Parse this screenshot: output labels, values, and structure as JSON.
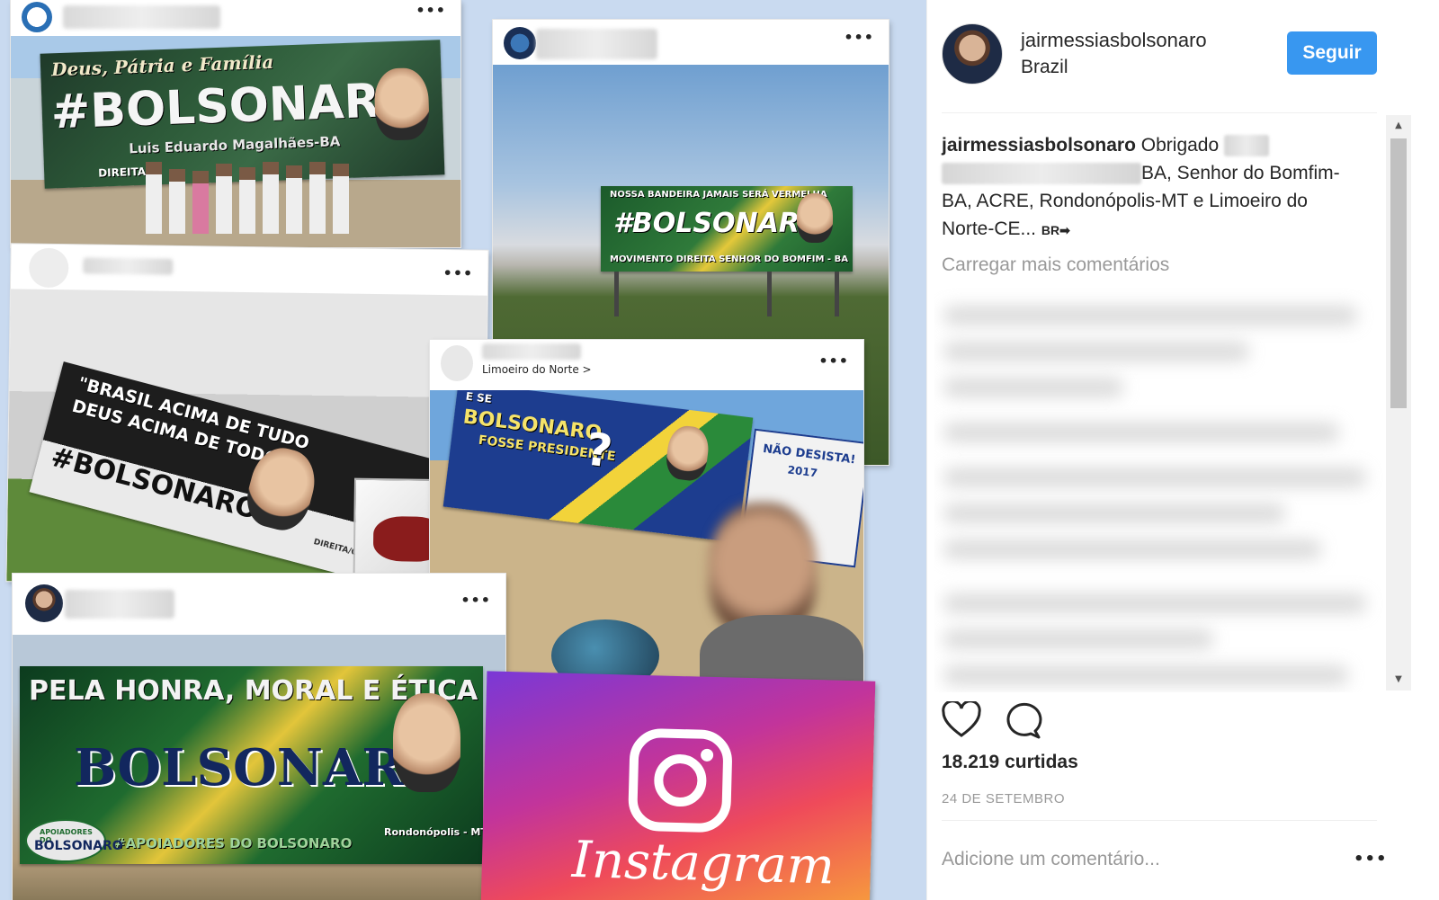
{
  "collage": {
    "card1": {
      "menu": "•••",
      "board_top": "Deus, Pátria e Família",
      "board_main": "#BOLSONARO",
      "board_sub": "Luis Eduardo Magalhães-BA",
      "board_logo": "DIREITA"
    },
    "card2": {
      "menu": "•••",
      "board_top": "NOSSA BANDEIRA JAMAIS SERÁ VERMELHA",
      "board_main": "#BOLSONARO",
      "board_sub": "MOVIMENTO DIREITA SENHOR DO BOMFIM - BA"
    },
    "card3": {
      "menu": "•••",
      "board_line1": "\"BRASIL ACIMA DE TUDO",
      "board_line2": "DEUS ACIMA DE TODOS\"",
      "board_main": "#BOLSONARO",
      "board_credit": "DIREITA/OK"
    },
    "card4": {
      "location": "Limoeiro do Norte >",
      "menu": "•••",
      "board_pre": "E SE",
      "board_main": "BOLSONARO",
      "board_sub": "FOSSE PRESIDENTE",
      "board_q": "?",
      "sign_line1": "NÃO DESISTA!",
      "sign_line2": "2017"
    },
    "card5": {
      "menu": "•••",
      "board_line1": "PELA HONRA, MORAL E ÉTICA",
      "board_main": "BOLSONARO",
      "board_tag": "#APOIADORES DO BOLSONARO",
      "board_city": "Rondonópolis - MT",
      "board_badge_top": "APOIADORES DO",
      "board_badge_main": "BOLSONARO"
    },
    "instagram_word": "Instagram"
  },
  "panel": {
    "username": "jairmessiasbolsonaro",
    "location": "Brazil",
    "follow_label": "Seguir",
    "caption": {
      "user": "jairmessiasbolsonaro",
      "part1": "Obrigado",
      "part2": "BA, Senhor do Bomfim-BA, ACRE, Rondonópolis-MT e Limoeiro do Norte-CE...",
      "more_flag": "BR➡"
    },
    "load_more": "Carregar mais comentários",
    "likes": "18.219 curtidas",
    "date": "24 DE SETEMBRO",
    "comment_placeholder": "Adicione um comentário...",
    "more_options": "•••",
    "scroll_up": "▲",
    "scroll_down": "▼"
  },
  "colors": {
    "accent": "#3897f0",
    "muted": "#999999",
    "text": "#262626"
  },
  "icons": [
    "heart-icon",
    "comment-icon",
    "instagram-logo-icon"
  ]
}
